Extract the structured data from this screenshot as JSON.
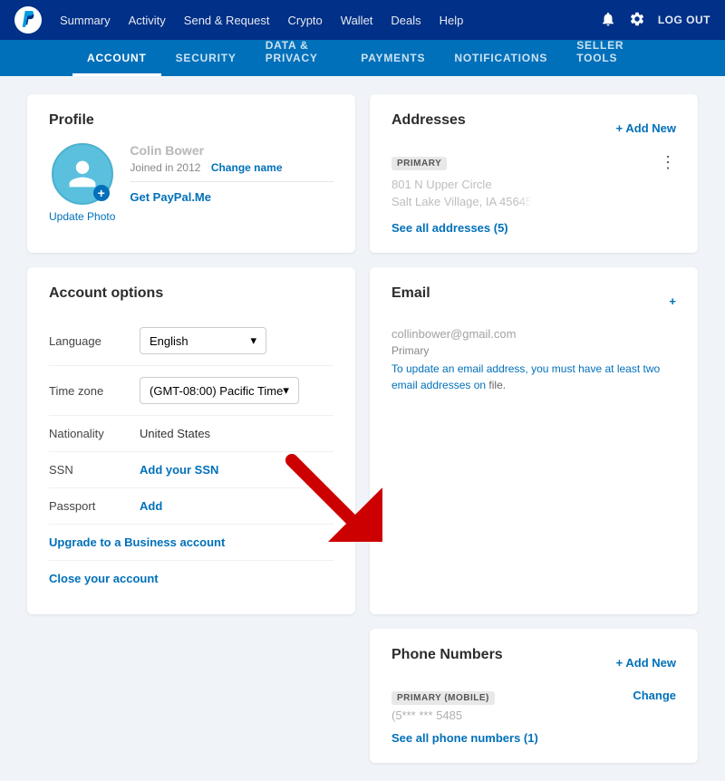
{
  "topnav": {
    "links": [
      {
        "label": "Summary",
        "id": "summary"
      },
      {
        "label": "Activity",
        "id": "activity"
      },
      {
        "label": "Send & Request",
        "id": "send-request"
      },
      {
        "label": "Crypto",
        "id": "crypto"
      },
      {
        "label": "Wallet",
        "id": "wallet"
      },
      {
        "label": "Deals",
        "id": "deals"
      },
      {
        "label": "Help",
        "id": "help"
      }
    ],
    "logout": "LOG OUT"
  },
  "subnav": {
    "links": [
      {
        "label": "ACCOUNT",
        "id": "account",
        "active": true
      },
      {
        "label": "SECURITY",
        "id": "security"
      },
      {
        "label": "DATA & PRIVACY",
        "id": "data-privacy"
      },
      {
        "label": "PAYMENTS",
        "id": "payments"
      },
      {
        "label": "NOTIFICATIONS",
        "id": "notifications"
      },
      {
        "label": "SELLER TOOLS",
        "id": "seller-tools"
      }
    ]
  },
  "profile": {
    "section_title": "Profile",
    "name": "Colin Bower",
    "joined": "Joined in 2012",
    "change_name": "Change name",
    "update_photo": "Update Photo",
    "paypalme": "Get PayPal.Me"
  },
  "account_options": {
    "section_title": "Account options",
    "rows": [
      {
        "label": "Language",
        "type": "select",
        "value": "English"
      },
      {
        "label": "Time zone",
        "type": "select",
        "value": "(GMT-08:00) Pacific Time"
      },
      {
        "label": "Nationality",
        "type": "text",
        "value": "United States"
      },
      {
        "label": "SSN",
        "type": "link",
        "value": "Add your SSN"
      },
      {
        "label": "Passport",
        "type": "link",
        "value": "Add"
      }
    ],
    "upgrade_link": "Upgrade to a Business account",
    "close_link": "Close your account"
  },
  "addresses": {
    "section_title": "Addresses",
    "add_new": "+ Add New",
    "badge": "PRIMARY",
    "address_line1": "801 N Upper Circle",
    "address_line2": "Salt Lake Village, IA 45645",
    "see_all": "See all addresses (5)"
  },
  "email": {
    "section_title": "Email",
    "add_icon": "+",
    "email": "collinbower@gmail.com",
    "primary": "Primary",
    "note": "To update an email address, you must have at least two email addresses on file."
  },
  "phone": {
    "section_title": "Phone Numbers",
    "add_new": "+ Add New",
    "badge": "PRIMARY (MOBILE)",
    "number": "(5*** *** 5485",
    "change": "Change",
    "see_all": "See all phone numbers (1)"
  }
}
